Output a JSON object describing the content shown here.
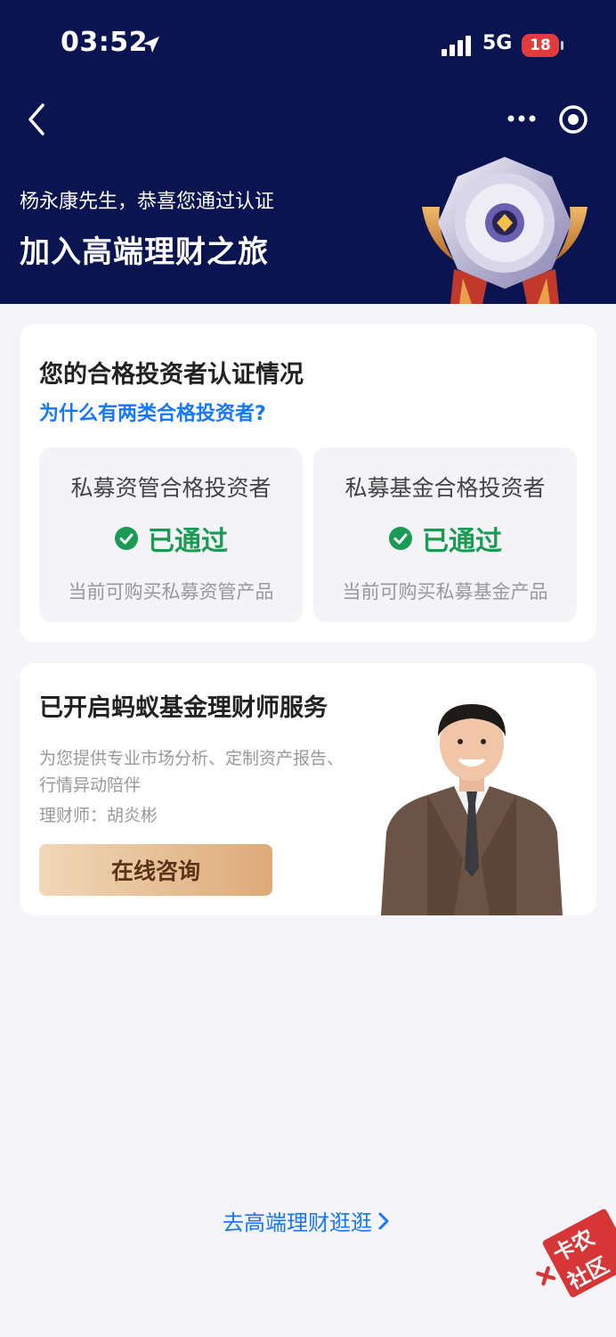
{
  "status_bar": {
    "time": "03:52",
    "network": "5G",
    "battery": "18"
  },
  "header": {
    "greeting": "杨永康先生，恭喜您通过认证",
    "slogan": "加入高端理财之旅"
  },
  "certification": {
    "title": "您的合格投资者认证情况",
    "why_link": "为什么有两类合格投资者?",
    "tiles": [
      {
        "name": "私募资管合格投资者",
        "status": "已通过",
        "desc": "当前可购买私募资管产品"
      },
      {
        "name": "私募基金合格投资者",
        "status": "已通过",
        "desc": "当前可购买私募基金产品"
      }
    ]
  },
  "advisor_service": {
    "title": "已开启蚂蚁基金理财师服务",
    "description": "为您提供专业市场分析、定制资产报告、行情异动陪伴",
    "advisor_line": "理财师：胡炎彬",
    "consult_button": "在线咨询"
  },
  "footer": {
    "explore_link": "去高端理财逛逛"
  },
  "watermark": {
    "text": "卡农社区"
  },
  "colors": {
    "header_bg": "#0a1450",
    "link": "#1677ff",
    "success": "#1a9b55",
    "consult_text": "#5a3417"
  }
}
